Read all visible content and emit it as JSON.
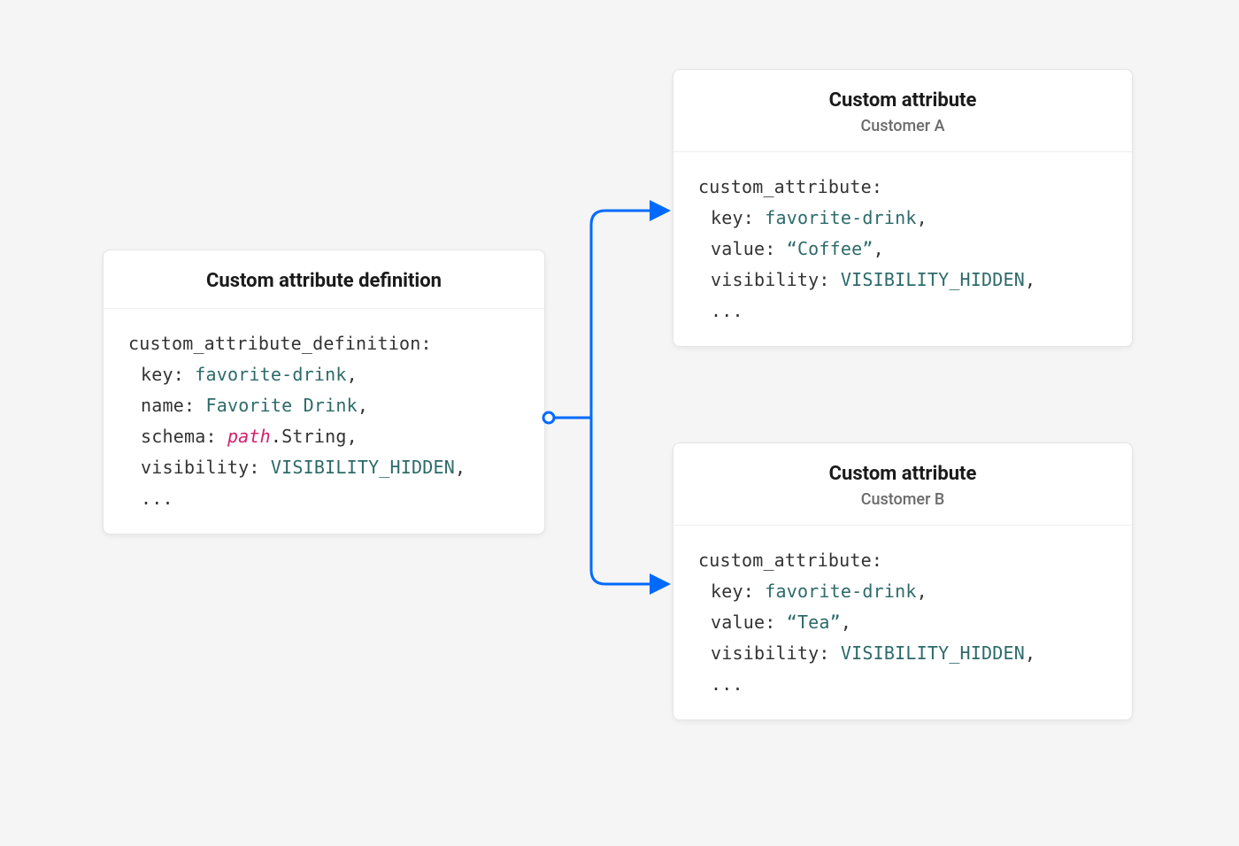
{
  "definition_card": {
    "title": "Custom attribute definition",
    "code": {
      "root": "custom_attribute_definition:",
      "key_label": "key:",
      "key_value": "favorite-drink",
      "name_label": "name:",
      "name_value": "Favorite Drink",
      "schema_label": "schema:",
      "schema_path": "path",
      "schema_type": ".String",
      "visibility_label": "visibility:",
      "visibility_value": "VISIBILITY_HIDDEN",
      "comma": ",",
      "dots": "..."
    }
  },
  "attr_card_a": {
    "title": "Custom attribute",
    "subtitle": "Customer A",
    "code": {
      "root": "custom_attribute:",
      "key_label": "key:",
      "key_value": "favorite-drink",
      "value_label": "value:",
      "value_value": "“Coffee”",
      "visibility_label": "visibility:",
      "visibility_value": "VISIBILITY_HIDDEN",
      "comma": ",",
      "dots": "..."
    }
  },
  "attr_card_b": {
    "title": "Custom attribute",
    "subtitle": "Customer B",
    "code": {
      "root": "custom_attribute:",
      "key_label": "key:",
      "key_value": "favorite-drink",
      "value_label": "value:",
      "value_value": "“Tea”",
      "visibility_label": "visibility:",
      "visibility_value": "VISIBILITY_HIDDEN",
      "comma": ",",
      "dots": "..."
    }
  },
  "connector": {
    "color": "#006aff"
  }
}
